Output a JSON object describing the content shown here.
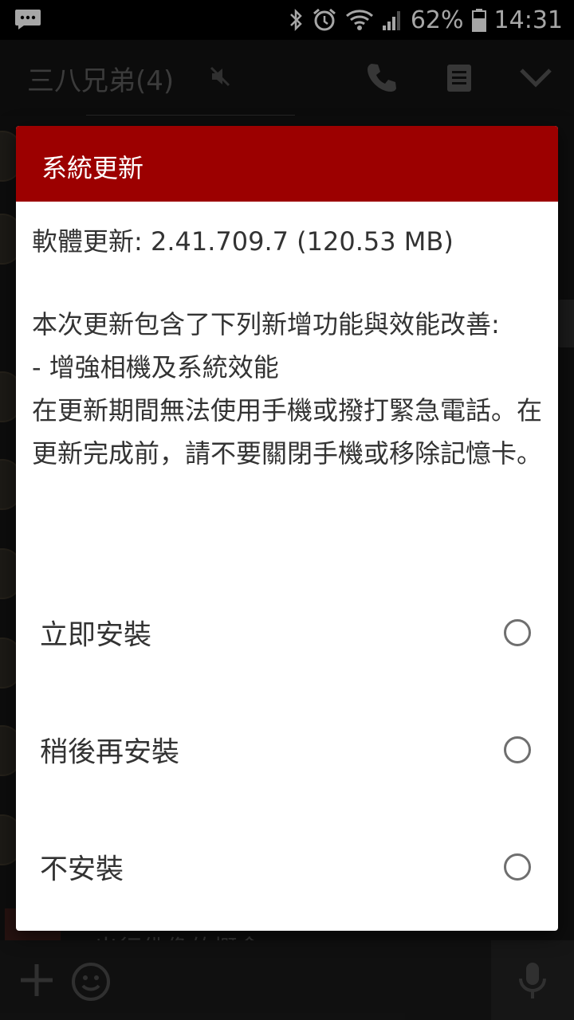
{
  "status_bar": {
    "battery": "62%",
    "time": "14:31"
  },
  "chat": {
    "title": "三八兄弟(4)",
    "partial_message": "出行佛像的概念"
  },
  "dialog": {
    "title": "系統更新",
    "version_line": "軟體更新: 2.41.709.7 (120.53 MB)",
    "intro": "本次更新包含了下列新增功能與效能改善:",
    "feature": "- 增強相機及系統效能",
    "warning": "在更新期間無法使用手機或撥打緊急電話。在更新完成前，請不要關閉手機或移除記憶卡。",
    "options": [
      {
        "label": "立即安裝",
        "selected": false
      },
      {
        "label": "稍後再安裝",
        "selected": false
      },
      {
        "label": "不安裝",
        "selected": false
      }
    ]
  },
  "colors": {
    "dialog_header": "#9c0000",
    "background": "#151515"
  }
}
